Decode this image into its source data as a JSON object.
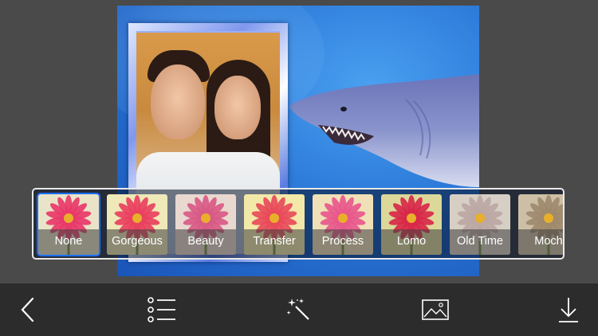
{
  "filters": {
    "items": [
      {
        "label": "None",
        "selected": true,
        "tone": "#e9e4c8",
        "petal": "#e83a6a"
      },
      {
        "label": "Gorgeous",
        "selected": false,
        "tone": "#efe8b8",
        "petal": "#e8405e"
      },
      {
        "label": "Beauty",
        "selected": false,
        "tone": "#e8d8d0",
        "petal": "#d85a86"
      },
      {
        "label": "Transfer",
        "selected": false,
        "tone": "#f2e8a8",
        "petal": "#e84a5a"
      },
      {
        "label": "Process",
        "selected": false,
        "tone": "#f0e0b8",
        "petal": "#e8588c"
      },
      {
        "label": "Lomo",
        "selected": false,
        "tone": "#dcd89a",
        "petal": "#d8284a"
      },
      {
        "label": "Old Time",
        "selected": false,
        "tone": "#d8cfc4",
        "petal": "#bca8a4"
      },
      {
        "label": "Moch",
        "selected": false,
        "tone": "#cdbfa6",
        "petal": "#9e8a6e"
      }
    ]
  },
  "toolbar": {
    "buttons": [
      {
        "name": "back-button",
        "icon": "chevron-left-icon"
      },
      {
        "name": "frames-list-button",
        "icon": "list-icon"
      },
      {
        "name": "effects-button",
        "icon": "magic-wand-icon"
      },
      {
        "name": "background-button",
        "icon": "image-icon"
      },
      {
        "name": "save-button",
        "icon": "download-icon"
      }
    ]
  },
  "colors": {
    "selected_border": "#1a70ff",
    "toolbar_bg": "#2c2c2c",
    "canvas_blue": "#2a78d8"
  }
}
